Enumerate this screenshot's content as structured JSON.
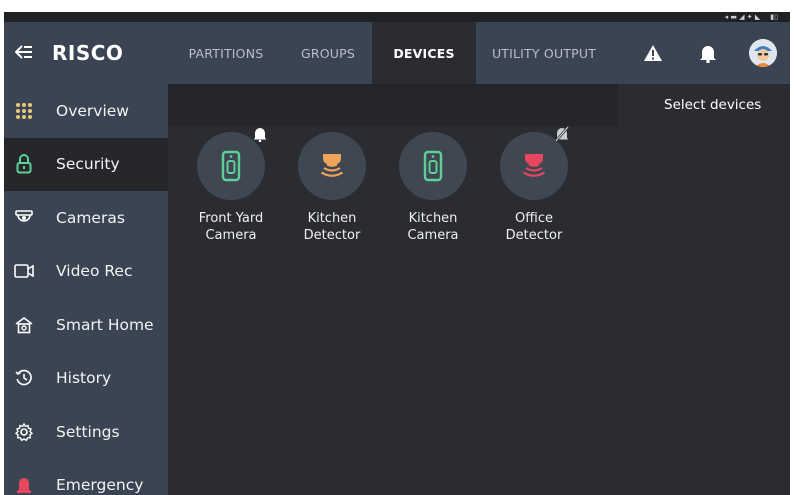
{
  "brand": {
    "name": "RISCO"
  },
  "sidebar": {
    "items": [
      {
        "label": "Overview",
        "icon": "grid-icon"
      },
      {
        "label": "Security",
        "icon": "lock-icon",
        "active": true
      },
      {
        "label": "Cameras",
        "icon": "camera-icon"
      },
      {
        "label": "Video Rec",
        "icon": "video-icon"
      },
      {
        "label": "Smart Home",
        "icon": "home-icon"
      },
      {
        "label": "History",
        "icon": "history-icon"
      },
      {
        "label": "Settings",
        "icon": "gear-icon"
      },
      {
        "label": "Emergency",
        "icon": "siren-icon"
      }
    ]
  },
  "tabs": [
    {
      "label": "PARTITIONS"
    },
    {
      "label": "GROUPS"
    },
    {
      "label": "DEVICES",
      "active": true
    },
    {
      "label": "UTILITY OUTPUT"
    }
  ],
  "header_icons": [
    "warning-icon",
    "bell-icon",
    "avatar"
  ],
  "actions": {
    "select_devices": "Select devices"
  },
  "devices": [
    {
      "name": "Front Yard\nCamera",
      "type": "camera",
      "badge": "bell-icon"
    },
    {
      "name": "Kitchen\nDetector",
      "type": "detector"
    },
    {
      "name": "Kitchen\nCamera",
      "type": "camera"
    },
    {
      "name": "Office\nDetector",
      "type": "detector-alarm",
      "badge": "bell-muted-icon"
    }
  ],
  "colors": {
    "sidebar_bg": "#3b4452",
    "content_bg": "#2a2c31",
    "camera_green": "#5ecf96",
    "detector_orange": "#f0a45a",
    "alarm_red": "#e8455f"
  }
}
